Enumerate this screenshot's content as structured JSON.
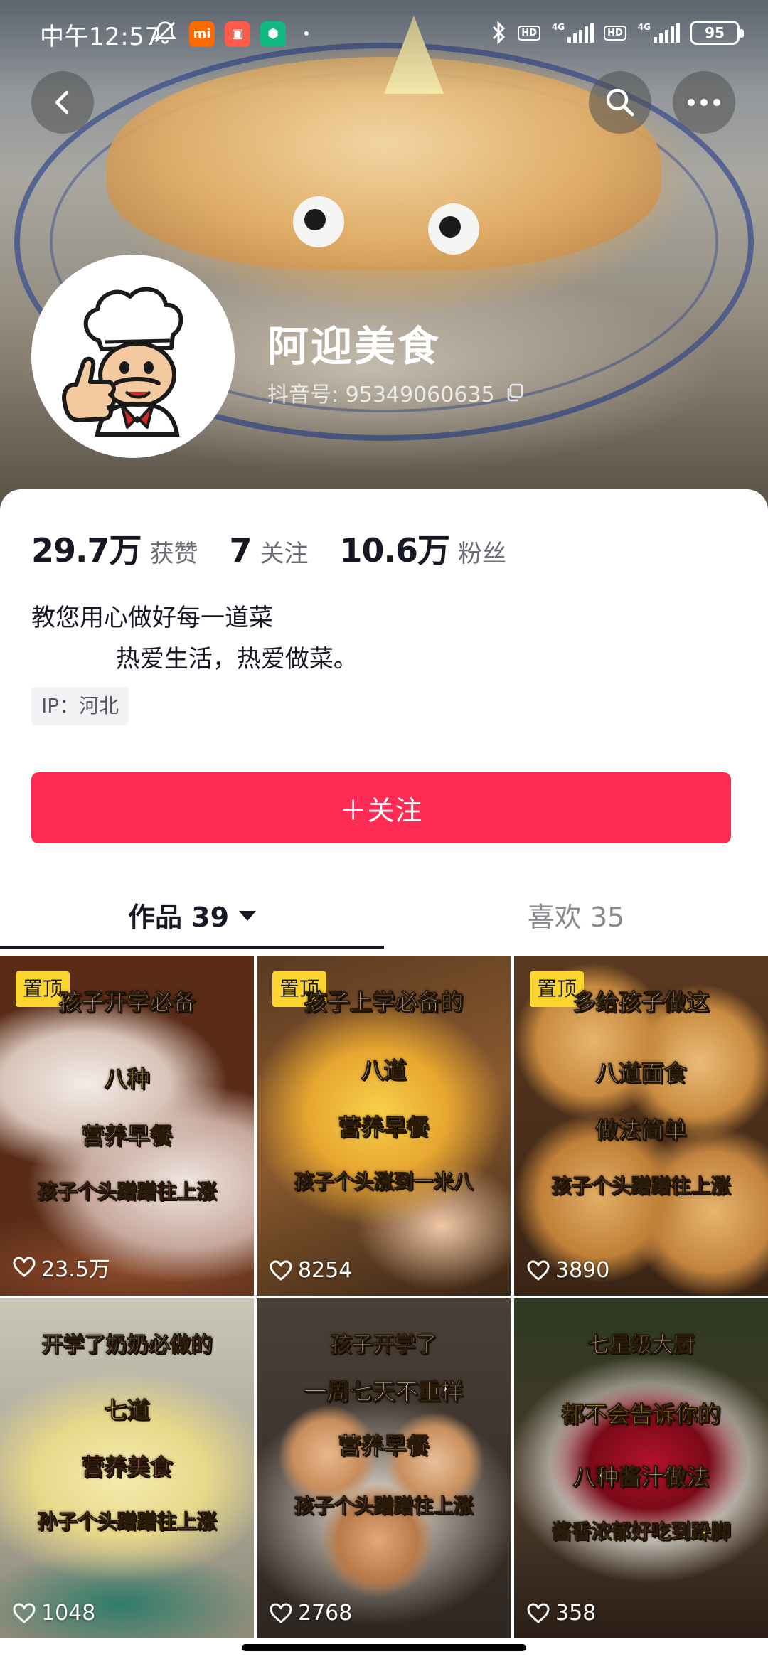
{
  "status_bar": {
    "time": "中午12:57",
    "app_icon_1": "mi",
    "app_icon_2": "▣",
    "app_icon_3": "⬢",
    "hd_label": "HD",
    "network_label": "4G",
    "battery": "95"
  },
  "profile": {
    "name": "阿迎美食",
    "douyin_id": "抖音号: 95349060635",
    "stats": [
      {
        "value": "29.7万",
        "label": "获赞"
      },
      {
        "value": "7",
        "label": "关注"
      },
      {
        "value": "10.6万",
        "label": "粉丝"
      }
    ],
    "bio_line1": "教您用心做好每一道菜",
    "bio_line2": "           热爱生活，热爱做菜。",
    "ip": "IP：河北",
    "follow_label": "＋关注"
  },
  "tabs": {
    "works": "作品 39",
    "likes": "喜欢 35"
  },
  "pin_label": "置顶",
  "videos": [
    {
      "likes": "23.5万",
      "pinned": true,
      "captions": [
        "孩子开学必备",
        "八种",
        "营养早餐",
        "孩子个头蹭蹭往上涨"
      ]
    },
    {
      "likes": "8254",
      "pinned": true,
      "captions": [
        "孩子上学必备的",
        "八道",
        "营养早餐",
        "孩子个头涨到一米八"
      ]
    },
    {
      "likes": "3890",
      "pinned": true,
      "captions": [
        "多给孩子做这",
        "八道面食",
        "做法简单",
        "孩子个头蹭蹭往上涨"
      ]
    },
    {
      "likes": "1048",
      "pinned": false,
      "captions": [
        "开学了奶奶必做的",
        "七道",
        "营养美食",
        "孙子个头蹭蹭往上涨"
      ]
    },
    {
      "likes": "2768",
      "pinned": false,
      "captions": [
        "孩子开学了",
        "一周七天不重样",
        "营养早餐",
        "孩子个头蹭蹭往上涨"
      ]
    },
    {
      "likes": "358",
      "pinned": false,
      "captions": [
        "七星级大厨",
        "都不会告诉你的",
        "八种酱汁做法",
        "酱香浓郁好吃到跺脚"
      ]
    }
  ],
  "colors": {
    "accent": "#fe2c55",
    "pin_badge": "#fdd531",
    "text_primary": "#161823",
    "text_secondary": "#6b6b73"
  },
  "icons": {
    "back": "chevron-left-icon",
    "search": "search-icon",
    "more": "more-dots-icon",
    "copy": "copy-icon",
    "like": "heart-outline-icon",
    "dropdown": "caret-down-icon"
  }
}
